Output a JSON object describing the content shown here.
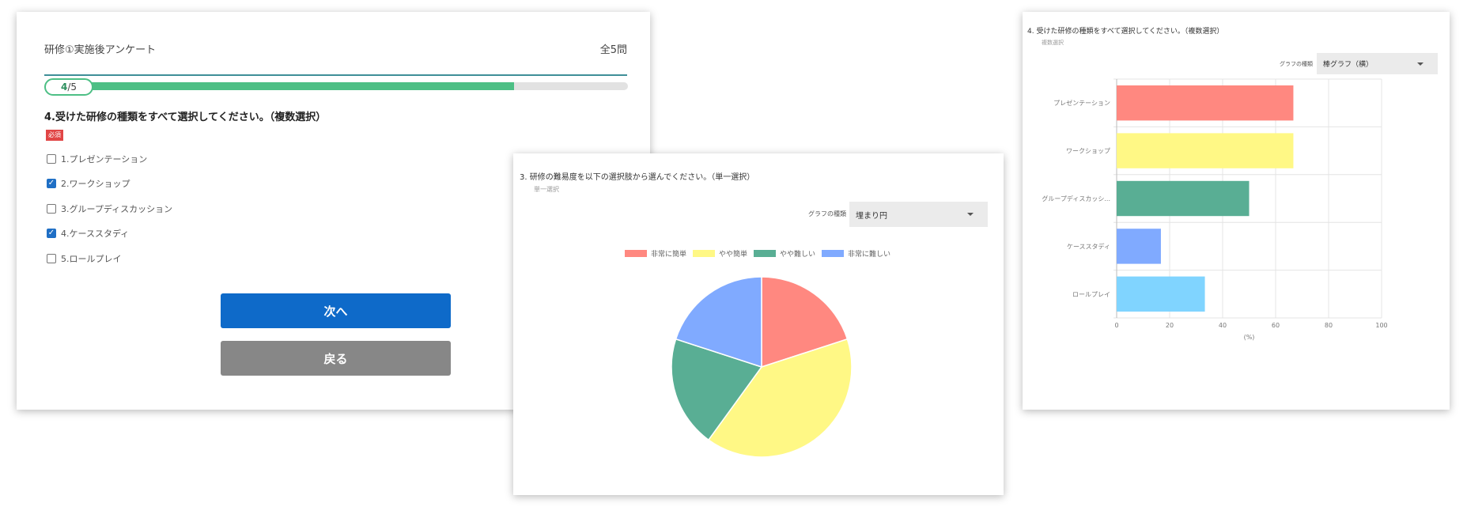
{
  "survey": {
    "title": "研修①実施後アンケート",
    "total": "全5問",
    "progress": {
      "current": "4",
      "sep": "/",
      "total": "5",
      "fraction": 0.8
    },
    "question": "4.受けた研修の種類をすべて選択してください。（複数選択）",
    "required": "必須",
    "options": [
      {
        "label": "1.プレゼンテーション",
        "checked": false
      },
      {
        "label": "2.ワークショップ",
        "checked": true
      },
      {
        "label": "3.グループディスカッション",
        "checked": false
      },
      {
        "label": "4.ケーススタディ",
        "checked": true
      },
      {
        "label": "5.ロールプレイ",
        "checked": false
      }
    ],
    "next_label": "次へ",
    "back_label": "戻る"
  },
  "pie_card": {
    "question": "3.   研修の難易度を以下の選択肢から選んでください。（単一選択）",
    "sub": "単一選択",
    "type_label": "グラフの種類",
    "type_value": "埋まり円"
  },
  "bar_card": {
    "question": "4.   受けた研修の種類をすべて選択してください。（複数選択）",
    "sub": "複数選択",
    "type_label": "グラフの種類",
    "type_value": "棒グラフ（横）"
  },
  "chart_data": [
    {
      "type": "pie",
      "categories": [
        "非常に簡単",
        "やや簡単",
        "やや難しい",
        "非常に難しい"
      ],
      "values": [
        20,
        40,
        20,
        20
      ],
      "colors": [
        "#ff8880",
        "#fff885",
        "#59ae94",
        "#80aaff"
      ],
      "legend": "top"
    },
    {
      "type": "bar",
      "orientation": "horizontal",
      "categories": [
        "プレゼンテーション",
        "ワークショップ",
        "グループディスカッシ...",
        "ケーススタディ",
        "ロールプレイ"
      ],
      "values": [
        66.7,
        66.7,
        50,
        16.7,
        33.3
      ],
      "colors": [
        "#ff8880",
        "#fff885",
        "#59ae94",
        "#80aaff",
        "#80d4ff"
      ],
      "xlim": [
        0,
        100
      ],
      "xticks": [
        "0",
        "20",
        "40",
        "60",
        "80",
        "100"
      ],
      "xlabel": "(%)",
      "grid": true
    }
  ]
}
